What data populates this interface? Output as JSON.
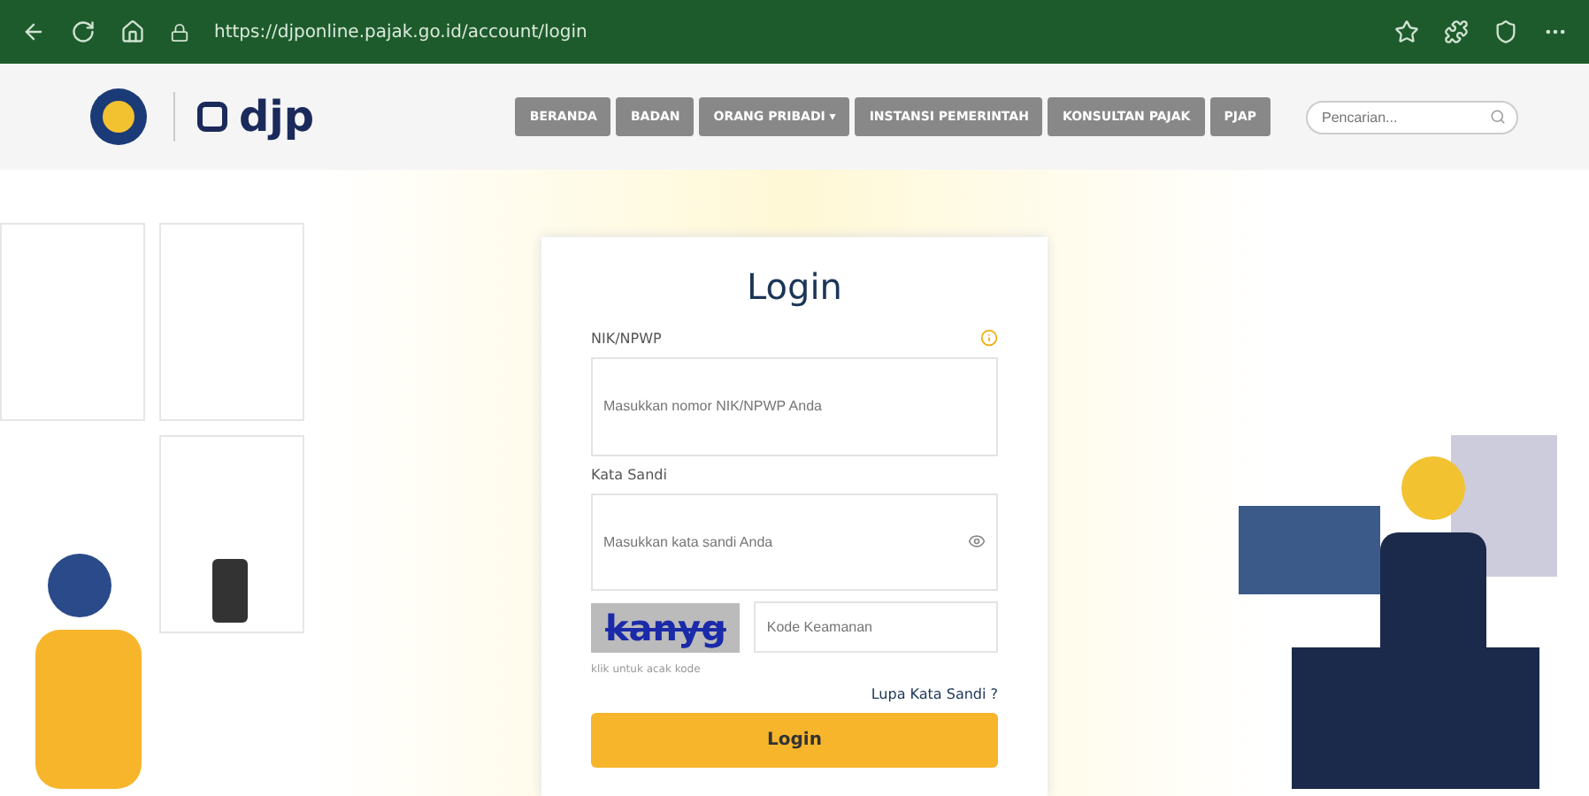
{
  "browser": {
    "url": "https://djponline.pajak.go.id/account/login"
  },
  "header": {
    "logo_text": "djp",
    "menu": [
      {
        "label": "BERANDA"
      },
      {
        "label": "BADAN"
      },
      {
        "label": "ORANG PRIBADI",
        "caret": "▾"
      },
      {
        "label": "INSTANSI PEMERINTAH"
      },
      {
        "label": "KONSULTAN PAJAK"
      },
      {
        "label": "PJAP"
      }
    ],
    "search": {
      "placeholder": "Pencarian..."
    }
  },
  "login": {
    "title": "Login",
    "id_label": "NIK/NPWP",
    "id_placeholder": "Masukkan nomor NIK/NPWP Anda",
    "password_label": "Kata Sandi",
    "password_placeholder": "Masukkan kata sandi Anda",
    "captcha_text": "kanyg",
    "captcha_placeholder": "Kode Keamanan",
    "captcha_hint": "klik untuk acak kode",
    "forgot_link": "Lupa Kata Sandi ?",
    "submit": "Login"
  }
}
